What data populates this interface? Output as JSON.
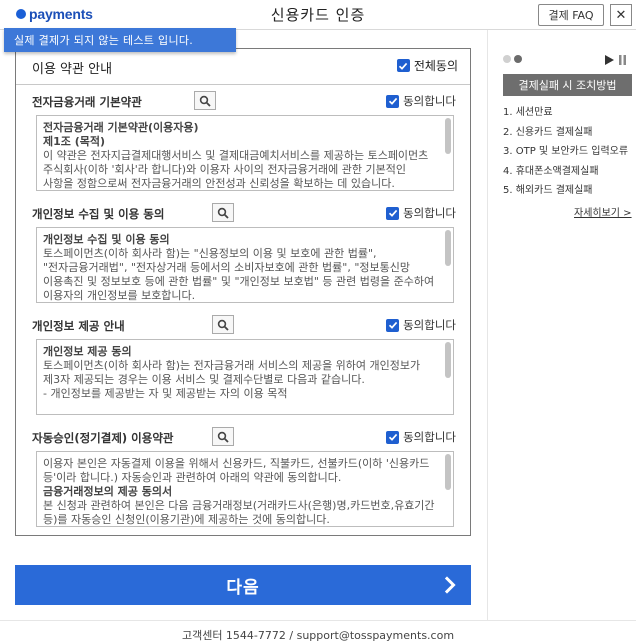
{
  "header": {
    "logo_text": "payments",
    "title": "신용카드 인증",
    "faq_label": "결제 FAQ",
    "close_symbol": "✕"
  },
  "banner": {
    "text": "실제 결제가 되지 않는 테스트 입니다."
  },
  "terms_panel": {
    "title": "이용 약관 안내",
    "all_agree_label": "전체동의",
    "all_agree_checked": true,
    "sections": [
      {
        "title": "전자금융거래 기본약관",
        "agree_label": "동의합니다",
        "checked": true,
        "lines": [
          "전자금융거래 기본약관(이용자용)",
          "제1조 (목적)",
          "이 약관은 전자지급결제대행서비스 및 결제대금예치서비스를 제공하는 토스페이먼츠 주식회사(이하 '회사'라 합니다)와 이용자 사이의 전자금융거래에 관한 기본적인 사항을 정함으로써 전자금융거래의 안전성과 신뢰성을 확보하는 데 있습니다."
        ]
      },
      {
        "title": "개인정보 수집 및 이용 동의",
        "agree_label": "동의합니다",
        "checked": true,
        "lines": [
          "개인정보 수집 및 이용 동의",
          "토스페이먼츠(이하 회사라 함)는 \"신용정보의 이용 및 보호에 관한 법률\", \"전자금융거래법\", \"전자상거래 등에서의 소비자보호에 관한 법률\", \"정보통신망 이용촉진 및 정보보호 등에 관한 법률\" 및 \"개인정보 보호법\" 등 관련 법령을 준수하여 이용자의 개인정보를 보호합니다."
        ]
      },
      {
        "title": "개인정보 제공 안내",
        "agree_label": "동의합니다",
        "checked": true,
        "lines": [
          "개인정보 제공 동의",
          "토스페이먼츠(이하 회사라 함)는 전자금융거래 서비스의 제공을 위하여 개인정보가 제3자 제공되는 경우는 이용 서비스 및 결제수단별로 다음과 같습니다.",
          "- 개인정보를 제공받는 자 및 제공받는 자의 이용 목적"
        ]
      },
      {
        "title": "자동승인(정기결제) 이용약관",
        "agree_label": "동의합니다",
        "checked": true,
        "lines": [
          "이용자 본인은 자동결제 이용을 위해서 신용카드, 직불카드, 선불카드(이하 '신용카드 등'이라 합니다.) 자동승인과 관련하여 아래의 약관에 동의합니다.",
          "금융거래정보의 제공 동의서",
          "본 신청과 관련하여 본인은 다음 금융거래정보(거래카드사(은행)명,카드번호,유효기간 등)를 자동승인 신청인(이용기관)에 제공하는 것에 동의합니다."
        ]
      }
    ]
  },
  "next_button": {
    "label": "다음"
  },
  "sidebar": {
    "help_title": "결제실패 시 조치방법",
    "items": [
      "1. 세션만료",
      "2. 신용카드 결제실패",
      "3. OTP 및 보안카드 입력오류",
      "4. 휴대폰소액결제실패",
      "5. 해외카드 결제실패"
    ],
    "more_label": "자세히보기 >"
  },
  "footer": {
    "text": "고객센터 1544-7772 / support@tosspayments.com"
  },
  "colors": {
    "brand_blue": "#2a6ad8",
    "checkbox_blue": "#1f5fd0",
    "banner_blue": "#3d78d8",
    "help_title_gray": "#6e6e6e"
  }
}
